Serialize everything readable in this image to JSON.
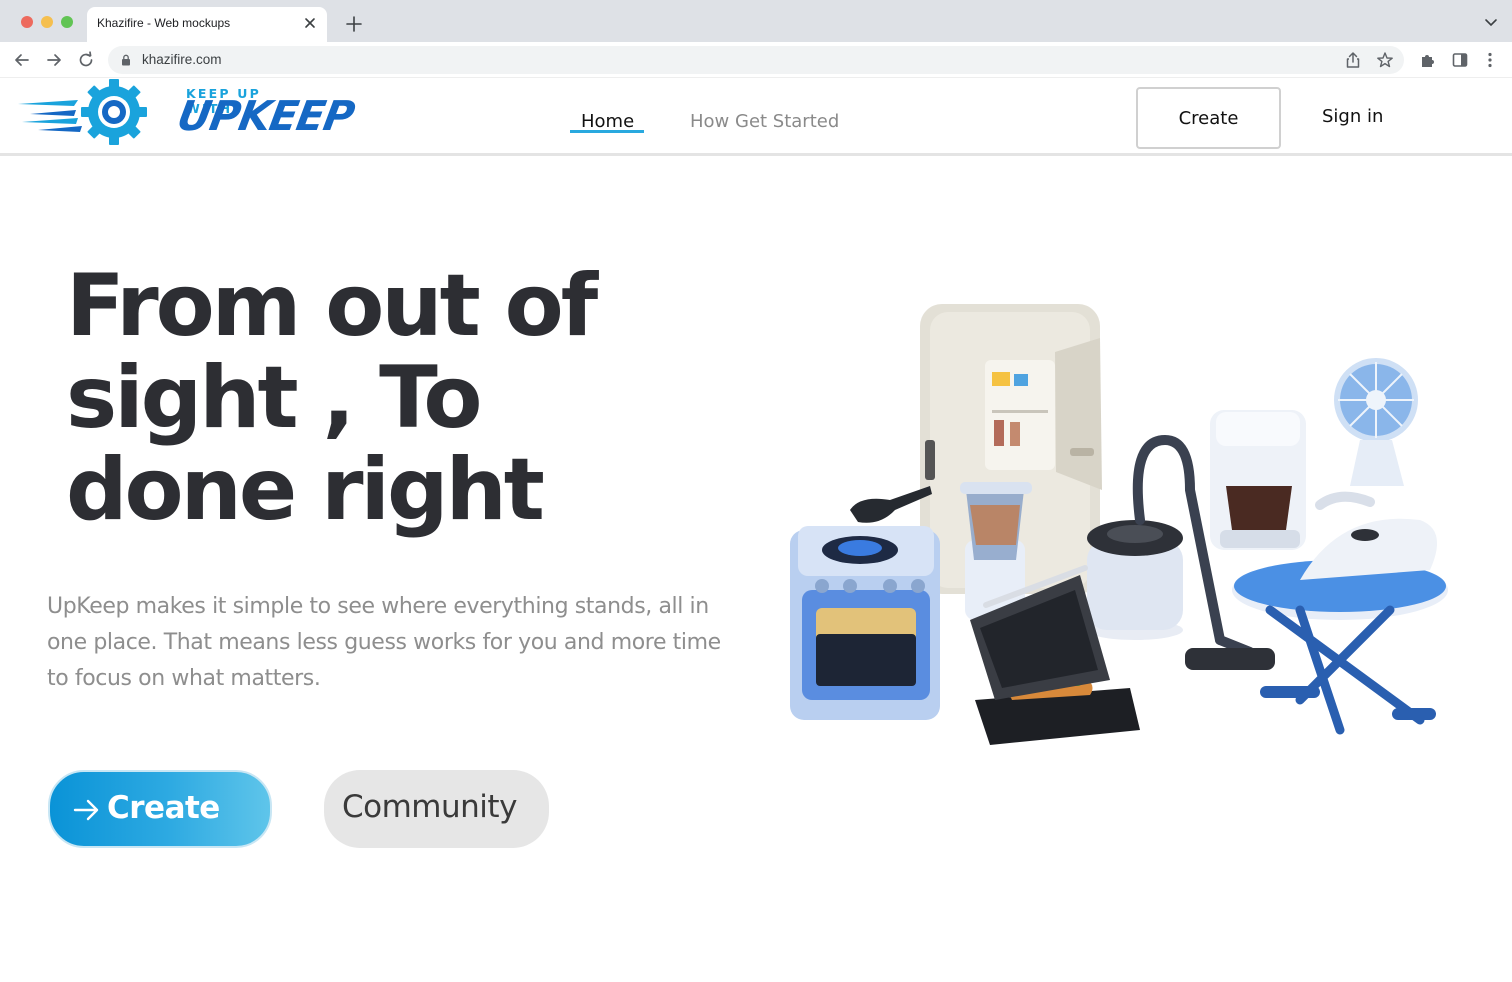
{
  "browser": {
    "tab_title": "Khazifire - Web mockups",
    "url": "khazifire.com",
    "traffic_colors": [
      "#ed6a5e",
      "#f5bf4f",
      "#61c454"
    ]
  },
  "header": {
    "logo_small": "KEEP UP WITH",
    "logo_big": "UPKEEP",
    "nav": {
      "home": "Home",
      "how_get_started": "How Get Started"
    },
    "create_label": "Create",
    "signin_label": "Sign in"
  },
  "hero": {
    "headline_lines": [
      "From out of",
      "sight , To",
      "done right"
    ],
    "subtext": "UpKeep makes it simple to see where everything stands, all in one place. That means less guess works for you and more time to focus on what matters.",
    "create_button": "Create",
    "community_button": "Community",
    "illustration": "home-appliances-illustration"
  },
  "colors": {
    "accent": "#29a9df",
    "brand_dark": "#1568c4",
    "headline": "#2d2e33",
    "muted": "#8e8e8e"
  }
}
